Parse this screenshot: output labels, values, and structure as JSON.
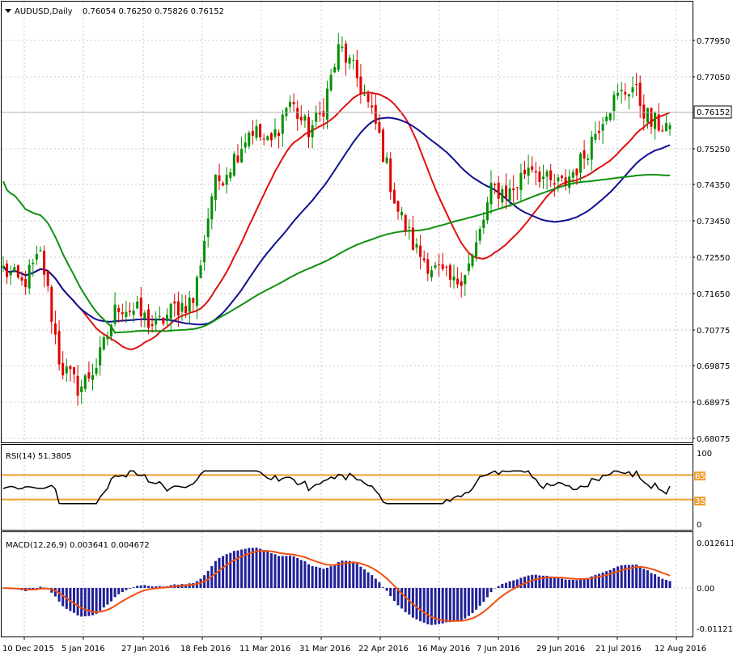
{
  "window": {
    "symbol_title": "AUDUSD,Daily",
    "ohlc": "0.76054 0.76250 0.75826 0.76152",
    "current_price": "0.76152"
  },
  "price_axis": {
    "labels": [
      "0.77950",
      "0.77050",
      "0.76152",
      "0.75250",
      "0.74350",
      "0.73450",
      "0.72550",
      "0.71650",
      "0.70775",
      "0.69875",
      "0.68975",
      "0.68075"
    ],
    "ylim": [
      0.68075,
      0.784
    ]
  },
  "rsi_panel": {
    "title": "RSI(14) 51.3805",
    "axis_labels": [
      "100",
      "65",
      "35",
      "0"
    ],
    "levels": [
      65,
      35
    ]
  },
  "macd_panel": {
    "title": "MACD(12,26,9) 0.003641 0.004672",
    "axis_labels": [
      "0.012611",
      "0.00",
      "-0.011216"
    ]
  },
  "date_axis": {
    "labels": [
      "10 Dec 2015",
      "5 Jan 2016",
      "27 Jan 2016",
      "18 Feb 2016",
      "11 Mar 2016",
      "31 Mar 2016",
      "22 Apr 2016",
      "16 May 2016",
      "7 Jun 2016",
      "29 Jun 2016",
      "21 Jul 2016",
      "12 Aug 2016"
    ]
  },
  "colors": {
    "bull_candle": "#009000",
    "bear_candle": "#e00000",
    "ma_fast": "#e01010",
    "ma_mid": "#101090",
    "ma_slow": "#109010",
    "rsi_line": "#000000",
    "rsi_levels": "#f0a030",
    "macd_hist": "#20209a",
    "macd_signal": "#f05010",
    "grid": "#c8c8c8"
  },
  "chart_data": {
    "type": "candlestick",
    "symbol": "AUDUSD",
    "timeframe": "Daily",
    "dates": [
      "10 Dec 2015",
      "5 Jan 2016",
      "27 Jan 2016",
      "18 Feb 2016",
      "11 Mar 2016",
      "31 Mar 2016",
      "22 Apr 2016",
      "16 May 2016",
      "7 Jun 2016",
      "29 Jun 2016",
      "21 Jul 2016",
      "12 Aug 2016"
    ],
    "close_at_labels": [
      0.72,
      0.7,
      0.709,
      0.716,
      0.756,
      0.764,
      0.773,
      0.722,
      0.744,
      0.746,
      0.752,
      0.766
    ],
    "last_ohlc": {
      "open": 0.76054,
      "high": 0.7625,
      "low": 0.75826,
      "close": 0.76152
    },
    "price_range": [
      0.68075,
      0.784
    ],
    "rsi_last": 51.3805,
    "macd_last": 0.003641,
    "macd_signal_last": 0.004672
  }
}
